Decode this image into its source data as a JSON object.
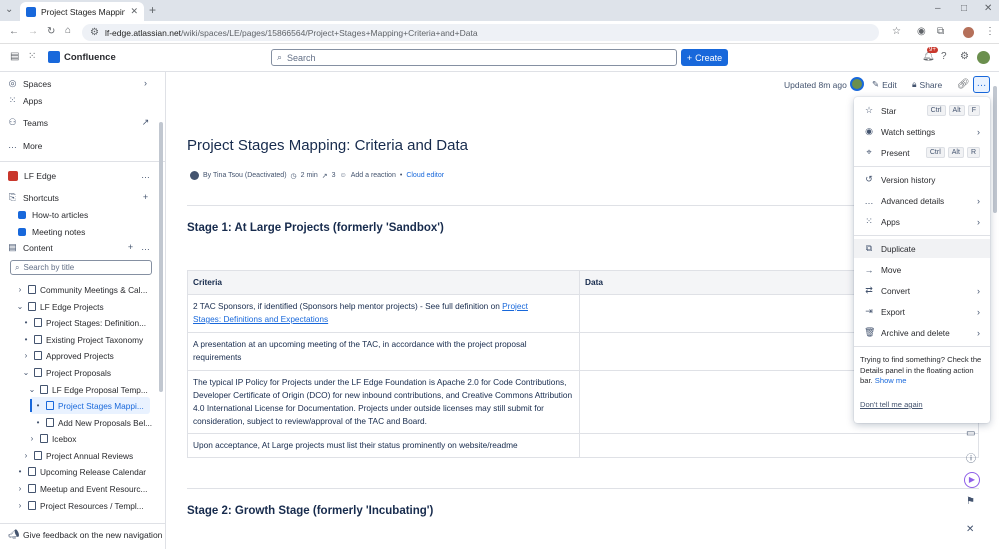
{
  "browser": {
    "tab_title": "Project Stages Mapping: Cr",
    "url_host": "lf-edge.atlassian.net",
    "url_path": "/wiki/spaces/LE/pages/15866564/Project+Stages+Mapping+Criteria+and+Data"
  },
  "topbar": {
    "product": "Confluence",
    "search_placeholder": "Search",
    "create_label": "Create",
    "notification_badge": "9+"
  },
  "sidebar": {
    "top_items": [
      {
        "label": "Spaces",
        "icon": "globe-icon"
      },
      {
        "label": "Apps",
        "icon": "apps-icon"
      },
      {
        "label": "Teams",
        "icon": "teams-icon"
      },
      {
        "label": "More",
        "icon": "more-icon"
      }
    ],
    "space_name": "LF Edge",
    "shortcuts_label": "Shortcuts",
    "shortcuts": [
      "How-to articles",
      "Meeting notes"
    ],
    "content_label": "Content",
    "filter_placeholder": "Search by title",
    "tree": [
      "Community Meetings & Cal...",
      "LF Edge Projects",
      "Project Stages: Definition...",
      "Existing Project Taxonomy",
      "Approved Projects",
      "Project Proposals",
      "LF Edge Proposal Temp...",
      "Project Stages Mappi...",
      "Add New Proposals Bel...",
      "Icebox",
      "Project Annual Reviews",
      "Upcoming Release Calendar",
      "Meetup and Event Resourc...",
      "Project Resources / Templ..."
    ],
    "feedback": "Give feedback on the new navigation"
  },
  "page": {
    "updated": "Updated 8m ago",
    "edit": "Edit",
    "share": "Share",
    "title": "Project Stages Mapping: Criteria and Data",
    "byline": {
      "author": "By Tina Tsou (Deactivated)",
      "read_time": "2 min",
      "views": "3",
      "reaction": "Add a reaction",
      "editor": "Cloud editor"
    },
    "stage1": "Stage 1: At Large Projects (formerly 'Sandbox')",
    "stage2": "Stage 2: Growth Stage (formerly 'Incubating')",
    "table": {
      "headers": [
        "Criteria",
        "Data"
      ],
      "row1_text": "2 TAC Sponsors, if identified (Sponsors help mentor projects) - See full definition on ",
      "row1_link_a": "Project ",
      "row1_link_b": "Stages: Definitions and Expectations",
      "row2": "A presentation at an upcoming meeting of the TAC, in accordance with the project proposal requirements",
      "row3": "The typical IP Policy for Projects under the LF Edge Foundation is Apache 2.0 for Code Contributions, Developer Certificate of Origin (DCO) for new inbound contributions, and Creative Commons Attribution 4.0 International License for Documentation. Projects under outside licenses may still submit for consideration, subject to review/approval of the TAC and Board.",
      "row4": "Upon acceptance, At Large projects must list their status prominently on website/readme"
    }
  },
  "menu": {
    "items": [
      {
        "label": "Star",
        "icon": "star-icon",
        "keys": [
          "Ctrl",
          "Alt",
          "F"
        ]
      },
      {
        "label": "Watch settings",
        "icon": "eye-icon",
        "arrow": true
      },
      {
        "label": "Present",
        "icon": "present-icon",
        "keys": [
          "Ctrl",
          "Alt",
          "R"
        ]
      },
      {
        "label": "Version history",
        "icon": "history-icon"
      },
      {
        "label": "Advanced details",
        "icon": "dots-icon",
        "arrow": true
      },
      {
        "label": "Apps",
        "icon": "apps-icon",
        "arrow": true
      },
      {
        "label": "Duplicate",
        "icon": "copy-icon"
      },
      {
        "label": "Move",
        "icon": "move-icon"
      },
      {
        "label": "Convert",
        "icon": "convert-icon",
        "arrow": true
      },
      {
        "label": "Export",
        "icon": "export-icon",
        "arrow": true
      },
      {
        "label": "Archive and delete",
        "icon": "trash-icon",
        "arrow": true
      }
    ],
    "tip": "Trying to find something? Check the Details panel in the floating action bar.",
    "tip_link": "Show me",
    "dismiss": "Don't tell me again"
  },
  "colors": {
    "brand": "#1868db",
    "text": "#172b4d",
    "selected": "#e9f2ff"
  }
}
